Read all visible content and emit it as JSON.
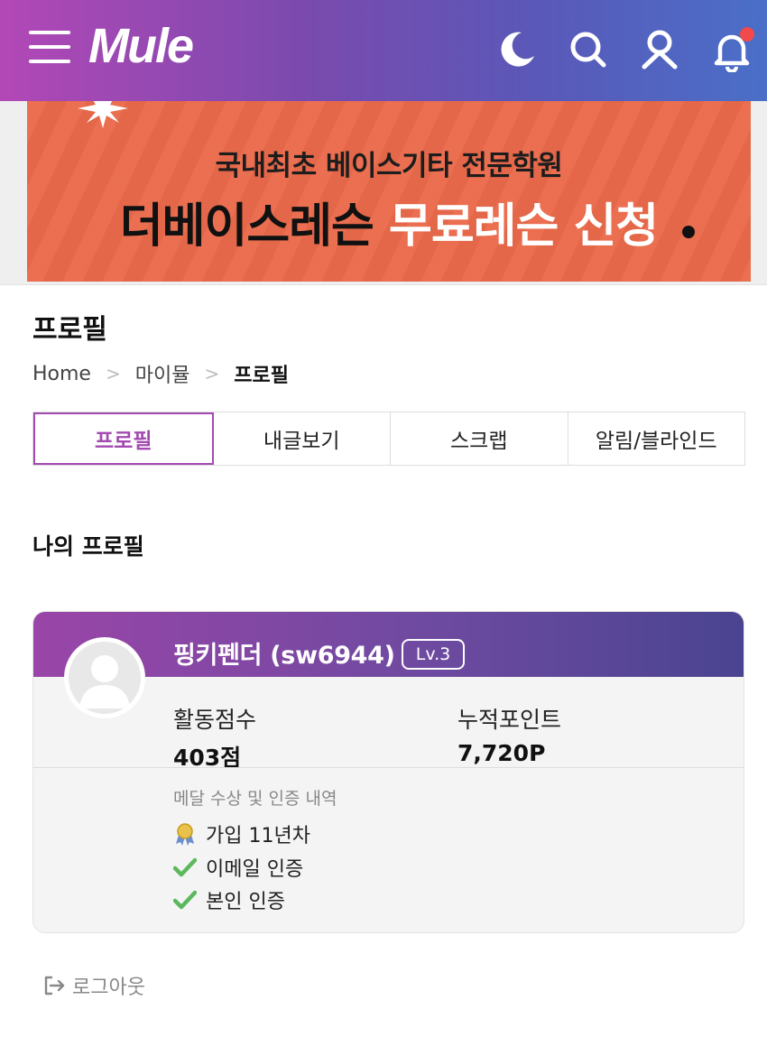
{
  "header": {
    "logo": "Mule",
    "icons": [
      "menu-icon",
      "moon-icon",
      "search-icon",
      "user-icon",
      "bell-icon"
    ],
    "has_notification": true,
    "gradient": [
      "#b248b6",
      "#4a6fc8"
    ]
  },
  "banner": {
    "line1": "국내최초 베이스기타 전문학원",
    "line2_dark": "더베이스레슨",
    "line2_light": "무료레슨 신청",
    "background": "#ea6a4a"
  },
  "page": {
    "title": "프로필",
    "breadcrumb": [
      "Home",
      "마이뮬",
      "프로필"
    ]
  },
  "tabs": [
    {
      "label": "프로필",
      "active": true
    },
    {
      "label": "내글보기",
      "active": false
    },
    {
      "label": "스크랩",
      "active": false
    },
    {
      "label": "알림/블라인드",
      "active": false
    }
  ],
  "profile": {
    "section_title": "나의 프로필",
    "username": "핑키펜더 (sw6944)",
    "level": "Lv.3",
    "activity_label": "활동점수",
    "activity_value": "403점",
    "points_label": "누적포인트",
    "points_value": "7,720P",
    "medal_title": "메달 수상 및 인증 내역",
    "medals": [
      {
        "icon": "medal-icon",
        "label": "가입 11년차"
      },
      {
        "icon": "check-icon",
        "label": "이메일 인증"
      },
      {
        "icon": "check-icon",
        "label": "본인 인증"
      }
    ]
  },
  "logout": {
    "label": "로그아웃"
  },
  "colors": {
    "accent": "#a24ab0",
    "notification": "#f04a4a"
  }
}
